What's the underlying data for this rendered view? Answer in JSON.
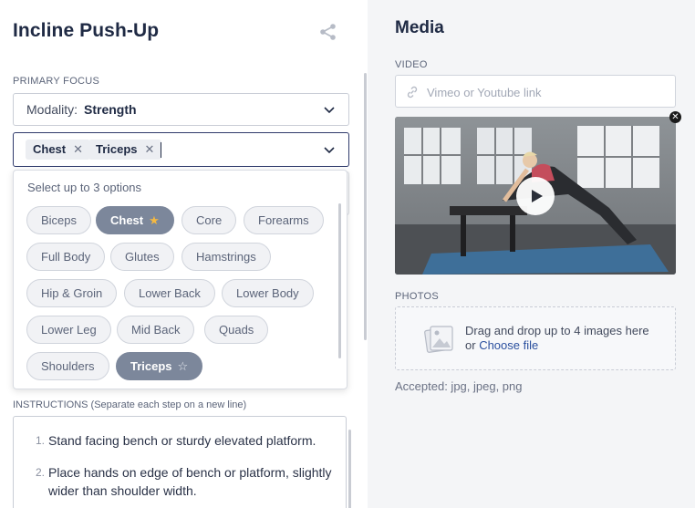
{
  "exercise": {
    "title": "Incline Push-Up"
  },
  "primary_focus": {
    "label": "PRIMARY FOCUS",
    "modality_label": "Modality:",
    "modality_value": "Strength",
    "selected_tags": [
      "Chest",
      "Triceps"
    ],
    "dropdown_hint": "Select up to 3 options",
    "options": [
      {
        "label": "Biceps",
        "selected": false
      },
      {
        "label": "Chest",
        "selected": true,
        "starred": true
      },
      {
        "label": "Core",
        "selected": false
      },
      {
        "label": "Forearms",
        "selected": false
      },
      {
        "label": "Full Body",
        "selected": false
      },
      {
        "label": "Glutes",
        "selected": false
      },
      {
        "label": "Hamstrings",
        "selected": false
      },
      {
        "label": "Hip & Groin",
        "selected": false
      },
      {
        "label": "Lower Back",
        "selected": false
      },
      {
        "label": "Lower Body",
        "selected": false
      },
      {
        "label": "Lower Leg",
        "selected": false
      },
      {
        "label": "Mid Back",
        "selected": false
      },
      {
        "label": "Quads",
        "selected": false
      },
      {
        "label": "Shoulders",
        "selected": false
      },
      {
        "label": "Triceps",
        "selected": true,
        "starred": false
      }
    ]
  },
  "instructions": {
    "label": "INSTRUCTIONS (Separate each step on a new line)",
    "steps": [
      "Stand facing bench or sturdy elevated platform.",
      "Place hands on edge of bench or platform, slightly wider than shoulder width."
    ]
  },
  "media": {
    "title": "Media",
    "video_label": "VIDEO",
    "video_placeholder": "Vimeo or Youtube link",
    "photos_label": "PHOTOS",
    "drop_text": "Drag and drop up to 4 images here",
    "drop_or": "or",
    "choose_file": "Choose file",
    "accepted": "Accepted: jpg, jpeg, png"
  },
  "colors": {
    "accent": "#2f3a6b",
    "selected_pill": "#7c879b",
    "star": "#f5b942",
    "link": "#2a4f9e"
  },
  "icons": [
    "share-icon",
    "chevron-down-icon",
    "close-icon",
    "star-icon",
    "link-icon",
    "play-icon",
    "image-icon"
  ]
}
